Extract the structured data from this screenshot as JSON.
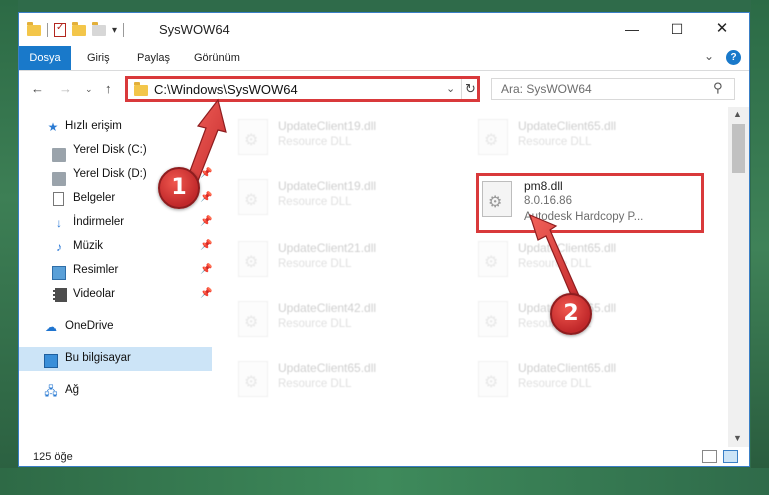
{
  "window": {
    "title": "SysWOW64",
    "qat_menu": "▾",
    "minimize": "—",
    "maximize": "☐",
    "close": "✕"
  },
  "ribbon": {
    "tabs": [
      "Dosya",
      "Giriş",
      "Paylaş",
      "Görünüm"
    ],
    "expand": "⌄",
    "help": "?"
  },
  "nav": {
    "back": "←",
    "forward": "→",
    "recent": "⌄",
    "up": "↑"
  },
  "address": {
    "path": "C:\\Windows\\SysWOW64",
    "dropdown": "⌄",
    "refresh": "↻"
  },
  "search": {
    "placeholder": "Ara: SysWOW64",
    "icon": "⚲"
  },
  "sidebar": {
    "items": [
      {
        "label": "Hızlı erişim",
        "icon": "star-icon",
        "pinned": false
      },
      {
        "label": "Yerel Disk (C:)",
        "icon": "drive-icon",
        "pinned": true
      },
      {
        "label": "Yerel Disk (D:)",
        "icon": "drive-icon",
        "pinned": true
      },
      {
        "label": "Belgeler",
        "icon": "documents-icon",
        "pinned": true
      },
      {
        "label": "İndirmeler",
        "icon": "download-icon",
        "pinned": true
      },
      {
        "label": "Müzik",
        "icon": "music-icon",
        "pinned": true
      },
      {
        "label": "Resimler",
        "icon": "pictures-icon",
        "pinned": true
      },
      {
        "label": "Videolar",
        "icon": "videos-icon",
        "pinned": true
      },
      {
        "label": "OneDrive",
        "icon": "cloud-icon",
        "pinned": false
      },
      {
        "label": "Bu bilgisayar",
        "icon": "computer-icon",
        "pinned": false,
        "selected": true
      },
      {
        "label": "Ağ",
        "icon": "network-icon",
        "pinned": false
      }
    ],
    "pin_glyph": "📌"
  },
  "files": [
    {
      "name": "UpdateClient19.dll",
      "type": "Resource DLL",
      "faded": true
    },
    {
      "name": "UpdateClient65.dll",
      "type": "Resource DLL",
      "faded": true
    },
    {
      "name": "UpdateClient19.dll",
      "type": "Resource DLL",
      "faded": true
    },
    {
      "name": "pm8.dll",
      "version": "8.0.16.86",
      "description": "Autodesk Hardcopy P...",
      "faded": false,
      "highlighted": true
    },
    {
      "name": "UpdateClient21.dll",
      "type": "Resource DLL",
      "faded": true
    },
    {
      "name": "UpdateClient65.dll",
      "type": "Resource DLL",
      "faded": true
    },
    {
      "name": "UpdateClient42.dll",
      "type": "Resource DLL",
      "faded": true
    },
    {
      "name": "UpdateClient65.dll",
      "type": "Resource DLL",
      "faded": true
    },
    {
      "name": "UpdateClient65.dll",
      "type": "Resource DLL",
      "faded": true
    },
    {
      "name": "UpdateClient65.dll",
      "type": "Resource DLL",
      "faded": true
    }
  ],
  "scrollbar": {
    "up": "▲",
    "down": "▼"
  },
  "status": {
    "item_count": "125 öğe"
  },
  "annotations": {
    "step1": "1",
    "step2": "2",
    "highlight_color": "#d9393b"
  }
}
